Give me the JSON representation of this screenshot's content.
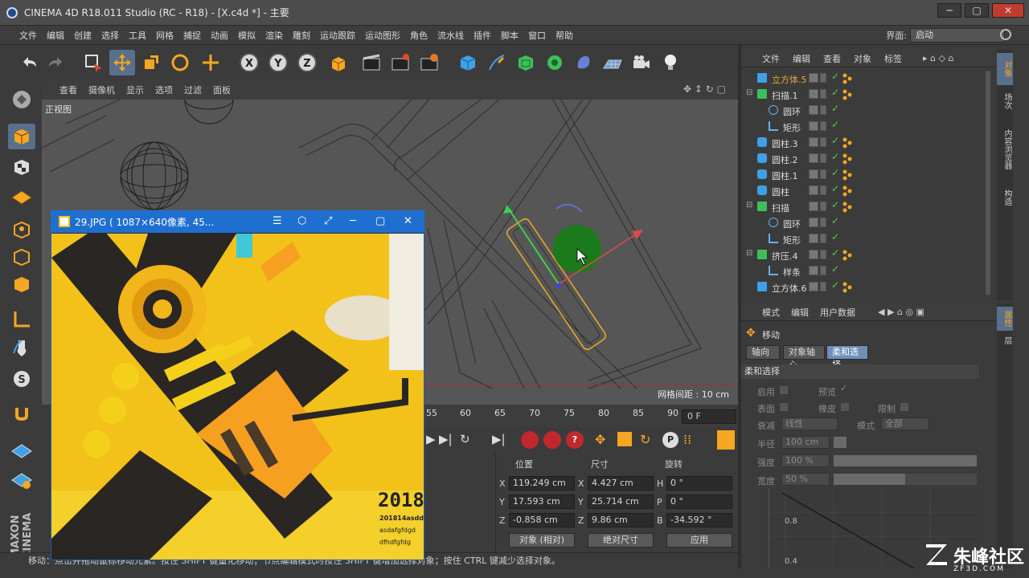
{
  "window": {
    "title": "CINEMA 4D R18.011 Studio (RC - R18) - [X.c4d *] - 主要",
    "min": "─",
    "max": "▢",
    "close": "✕"
  },
  "menu": [
    "文件",
    "编辑",
    "创建",
    "选择",
    "工具",
    "网格",
    "捕捉",
    "动画",
    "模拟",
    "渲染",
    "雕刻",
    "运动跟踪",
    "运动图形",
    "角色",
    "流水线",
    "插件",
    "脚本",
    "窗口",
    "帮助"
  ],
  "layout": {
    "label": "界面:",
    "value": "启动"
  },
  "viewport": {
    "menu": [
      "查看",
      "摄像机",
      "显示",
      "选项",
      "过滤",
      "面板"
    ],
    "label": "正视图",
    "grid_spacing": "网格间距 : 10 cm"
  },
  "timeline": {
    "ticks": [
      "55",
      "60",
      "65",
      "70",
      "75",
      "80",
      "85",
      "90"
    ],
    "frame": "0 F"
  },
  "coords": {
    "headers": [
      "位置",
      "尺寸",
      "旋转"
    ],
    "rows": [
      {
        "axis1": "X",
        "pos": "119.249 cm",
        "axis2": "X",
        "size": "4.427 cm",
        "axis3": "H",
        "rot": "0 °"
      },
      {
        "axis1": "Y",
        "pos": "17.593 cm",
        "axis2": "Y",
        "size": "25.714 cm",
        "axis3": "P",
        "rot": "0 °"
      },
      {
        "axis1": "Z",
        "pos": "-0.858 cm",
        "axis2": "Z",
        "size": "9.86 cm",
        "axis3": "B",
        "rot": "-34.592 °"
      }
    ],
    "mode1": "对象 (相对)",
    "mode2": "绝对尺寸",
    "apply": "应用"
  },
  "status": "移动：点击并拖动鼠标移动元素。按住 SHIFT 键量化移动；节点编辑模式时按住 SHIFT 键增加选择对象；按住 CTRL 键减少选择对象。",
  "objects": {
    "menu": [
      "文件",
      "编辑",
      "查看",
      "对象",
      "标签"
    ],
    "items": [
      {
        "name": "立方体.5",
        "selected": true
      },
      {
        "name": "扫描.1"
      },
      {
        "name": "圆环"
      },
      {
        "name": "矩形"
      },
      {
        "name": "圆柱.3"
      },
      {
        "name": "圆柱.2"
      },
      {
        "name": "圆柱.1"
      },
      {
        "name": "圆柱"
      },
      {
        "name": "扫描"
      },
      {
        "name": "圆环"
      },
      {
        "name": "矩形"
      },
      {
        "name": "挤压.4"
      },
      {
        "name": "样条"
      },
      {
        "name": "立方体.6"
      }
    ]
  },
  "side_tabs_top": [
    "对象",
    "场次",
    "内容浏览器",
    "构造"
  ],
  "side_tabs_bottom": [
    "属性",
    "层"
  ],
  "attributes": {
    "menu": [
      "模式",
      "编辑",
      "用户数据"
    ],
    "tool_name": "移动",
    "tabs": [
      "轴向",
      "对象轴心",
      "柔和选择"
    ],
    "section": "柔和选择",
    "enable": "启用",
    "preview": "预览",
    "surface": "表面",
    "rubber": "橡皮",
    "restrict": "限制",
    "falloff_label": "衰减",
    "falloff_value": "线性",
    "mode_label": "模式",
    "mode_value": "全部",
    "radius_label": "半径",
    "radius_value": "100 cm",
    "strength_label": "强度",
    "strength_value": "100 %",
    "width_label": "宽度",
    "width_value": "50 %",
    "width_level": 0.5,
    "strength_level": 1.0,
    "graph_val1": "0.8",
    "graph_val2": "0.4"
  },
  "image_viewer": {
    "title": "29.JPG ( 1087×640像素, 45...",
    "btns": [
      "☰",
      "⬡",
      "⤢",
      "─",
      "▢",
      "✕"
    ],
    "poster_year": "2018",
    "poster_lines": [
      "201814asdd",
      "asdafgfdgd",
      "dfhdfgfdg"
    ]
  },
  "watermark": {
    "text": "朱峰社区",
    "sub": "ZF3D.COM"
  },
  "maxon_label": "MAXON CINEMA"
}
